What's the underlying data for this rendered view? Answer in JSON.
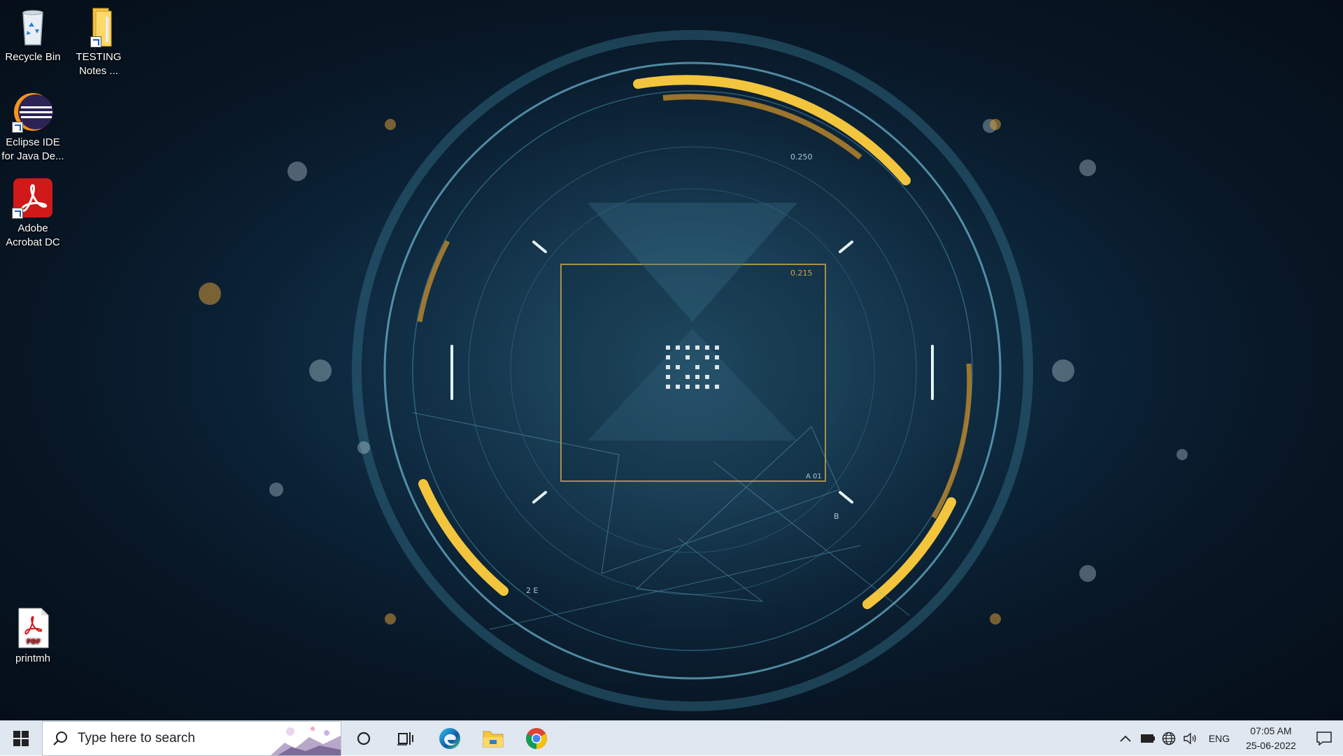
{
  "desktop": {
    "icons": [
      {
        "label": "Recycle Bin",
        "icon": "recycle-bin-icon"
      },
      {
        "label": "TESTING Notes ...",
        "icon": "folder-icon"
      },
      {
        "label": "Eclipse IDE for Java De...",
        "icon": "eclipse-icon"
      },
      {
        "label": "Adobe Acrobat DC",
        "icon": "acrobat-icon"
      },
      {
        "label": "printmh",
        "icon": "pdf-file-icon"
      }
    ],
    "wallpaper": {
      "readout_1": "0.250",
      "readout_2": "0.215",
      "readout_3": "A 01",
      "readout_4": "B",
      "readout_5": "2 E",
      "accent": "#f2c53d",
      "ring": "#7fd3ee"
    }
  },
  "taskbar": {
    "search_placeholder": "Type here to search",
    "pinned": [
      {
        "name": "Microsoft Edge",
        "icon": "edge-icon"
      },
      {
        "name": "File Explorer",
        "icon": "file-explorer-icon"
      },
      {
        "name": "Google Chrome",
        "icon": "chrome-icon"
      }
    ],
    "tray": {
      "language": "ENG",
      "time": "07:05 AM",
      "date": "25-06-2022"
    }
  }
}
